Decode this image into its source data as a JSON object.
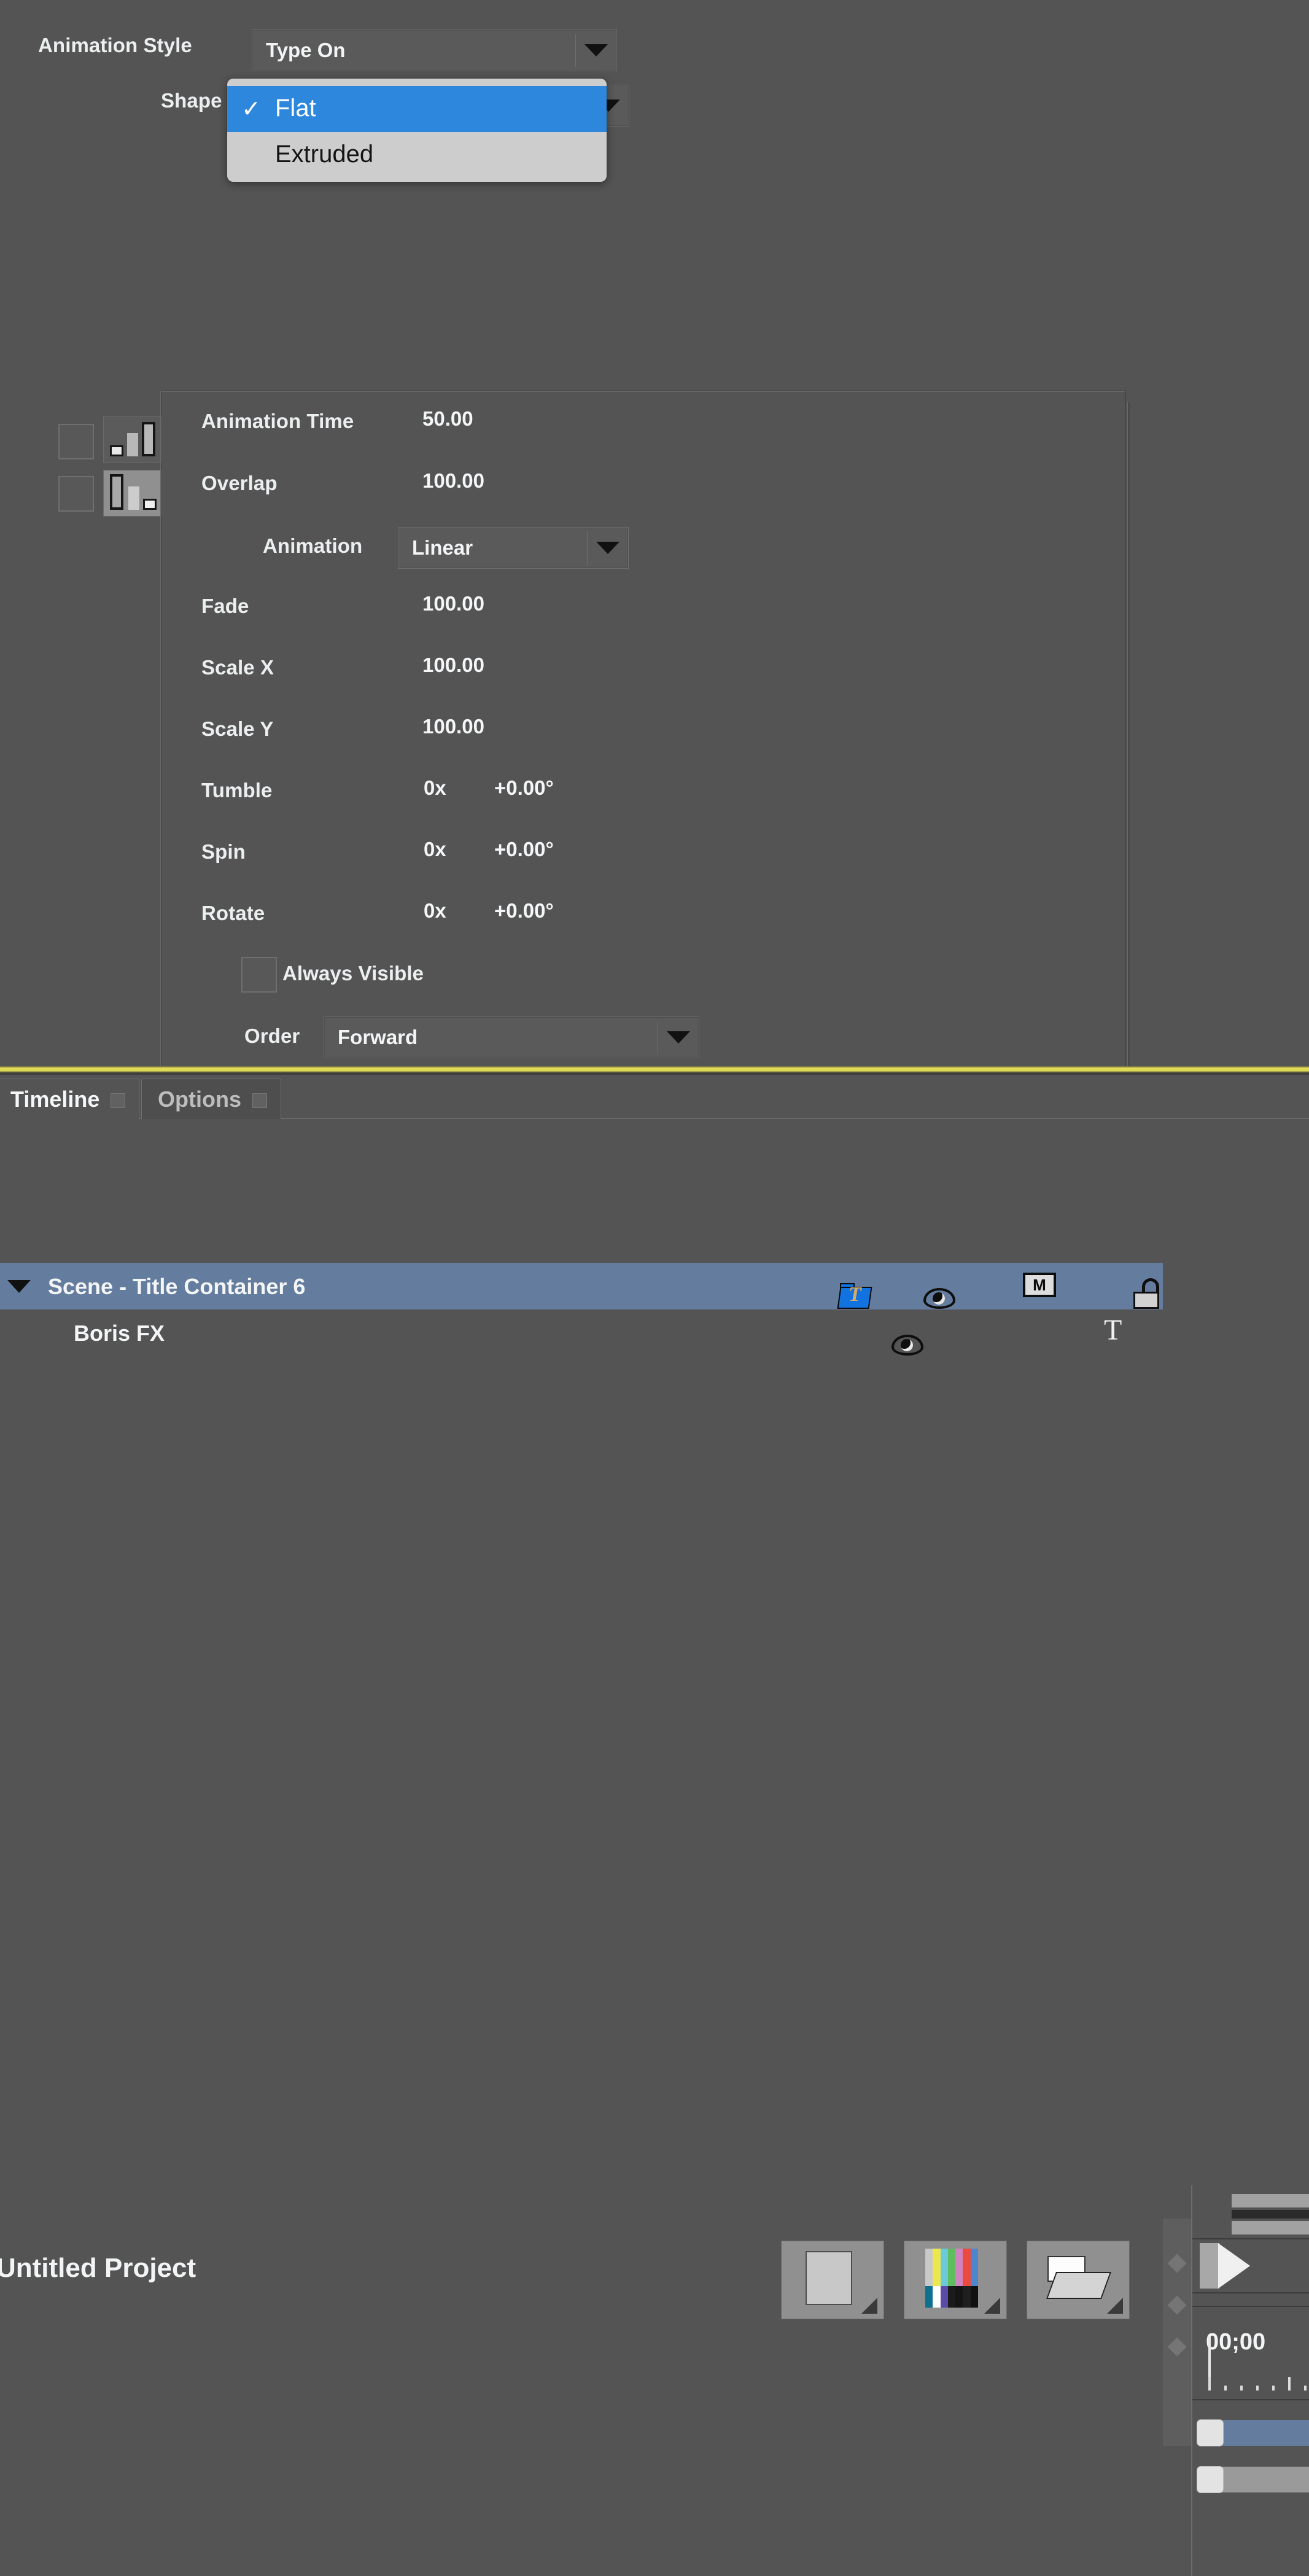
{
  "colors": {
    "panel_bg": "#545454",
    "accent_blue": "#2d87dd",
    "selection_blue": "#647d9e",
    "divider_yellow": "#e2dc5a",
    "popup_bg": "#cdcdcd"
  },
  "params": {
    "animation_style": {
      "label": "Animation Style",
      "value": "Type On"
    },
    "shape": {
      "label": "Shape",
      "value": "Flat"
    },
    "shape_popup": {
      "options": [
        {
          "label": "Flat",
          "checked": true
        },
        {
          "label": "Extruded",
          "checked": false
        }
      ],
      "check_glyph": "✓"
    },
    "ramp_icons": [
      {
        "name": "ramp-up-icon",
        "checked": false,
        "active": false
      },
      {
        "name": "ramp-down-icon",
        "checked": false,
        "active": true
      }
    ],
    "rows": [
      {
        "label": "Animation Time",
        "value": "50.00"
      },
      {
        "label": "Overlap",
        "value": "100.00"
      },
      {
        "label": "Fade",
        "value": "100.00"
      },
      {
        "label": "Scale X",
        "value": "100.00"
      },
      {
        "label": "Scale Y",
        "value": "100.00"
      }
    ],
    "angle_rows": [
      {
        "label": "Tumble",
        "revolutions": "0x",
        "degrees": "+0.00°"
      },
      {
        "label": "Spin",
        "revolutions": "0x",
        "degrees": "+0.00°"
      },
      {
        "label": "Rotate",
        "revolutions": "0x",
        "degrees": "+0.00°"
      }
    ],
    "animation_curve": {
      "label": "Animation",
      "value": "Linear"
    },
    "always_visible": {
      "label": "Always Visible",
      "checked": false
    },
    "order": {
      "label": "Order",
      "value": "Forward"
    }
  },
  "timeline": {
    "tabs": [
      {
        "label": "Timeline",
        "active": true
      },
      {
        "label": "Options",
        "active": false
      }
    ],
    "project_title": "Untitled Project",
    "toolbar": [
      {
        "name": "new-media-button",
        "icon": "blank-media-icon"
      },
      {
        "name": "new-colorbars-button",
        "icon": "color-bars-icon"
      },
      {
        "name": "new-container-button",
        "icon": "folder-icon"
      }
    ],
    "color_bars": {
      "top": [
        "#c9c9c9",
        "#ece74e",
        "#6cc9dc",
        "#5dbd5f",
        "#d083bf",
        "#ec4a3e",
        "#4d86cd"
      ],
      "bottom": [
        "#0e6f8f",
        "#fcfcfc",
        "#5a4ba8",
        "#1b1b1b",
        "#141414",
        "#1f1f1f",
        "#101010"
      ]
    },
    "rows": [
      {
        "name": "Scene - Title Container 6",
        "indent": 0,
        "selected": true,
        "expanded": true,
        "icons": [
          "title-container-icon",
          "eye-icon",
          "matte-box-icon",
          "unlock-icon"
        ],
        "matte_letter": "M",
        "bar_color": "blue"
      },
      {
        "name": "Boris FX",
        "indent": 1,
        "selected": false,
        "expanded": false,
        "icons": [
          "eye-icon",
          "text-layer-icon"
        ],
        "text_glyph": "T",
        "bar_color": "gray"
      }
    ],
    "ruler": {
      "timecode": "00;00"
    }
  }
}
